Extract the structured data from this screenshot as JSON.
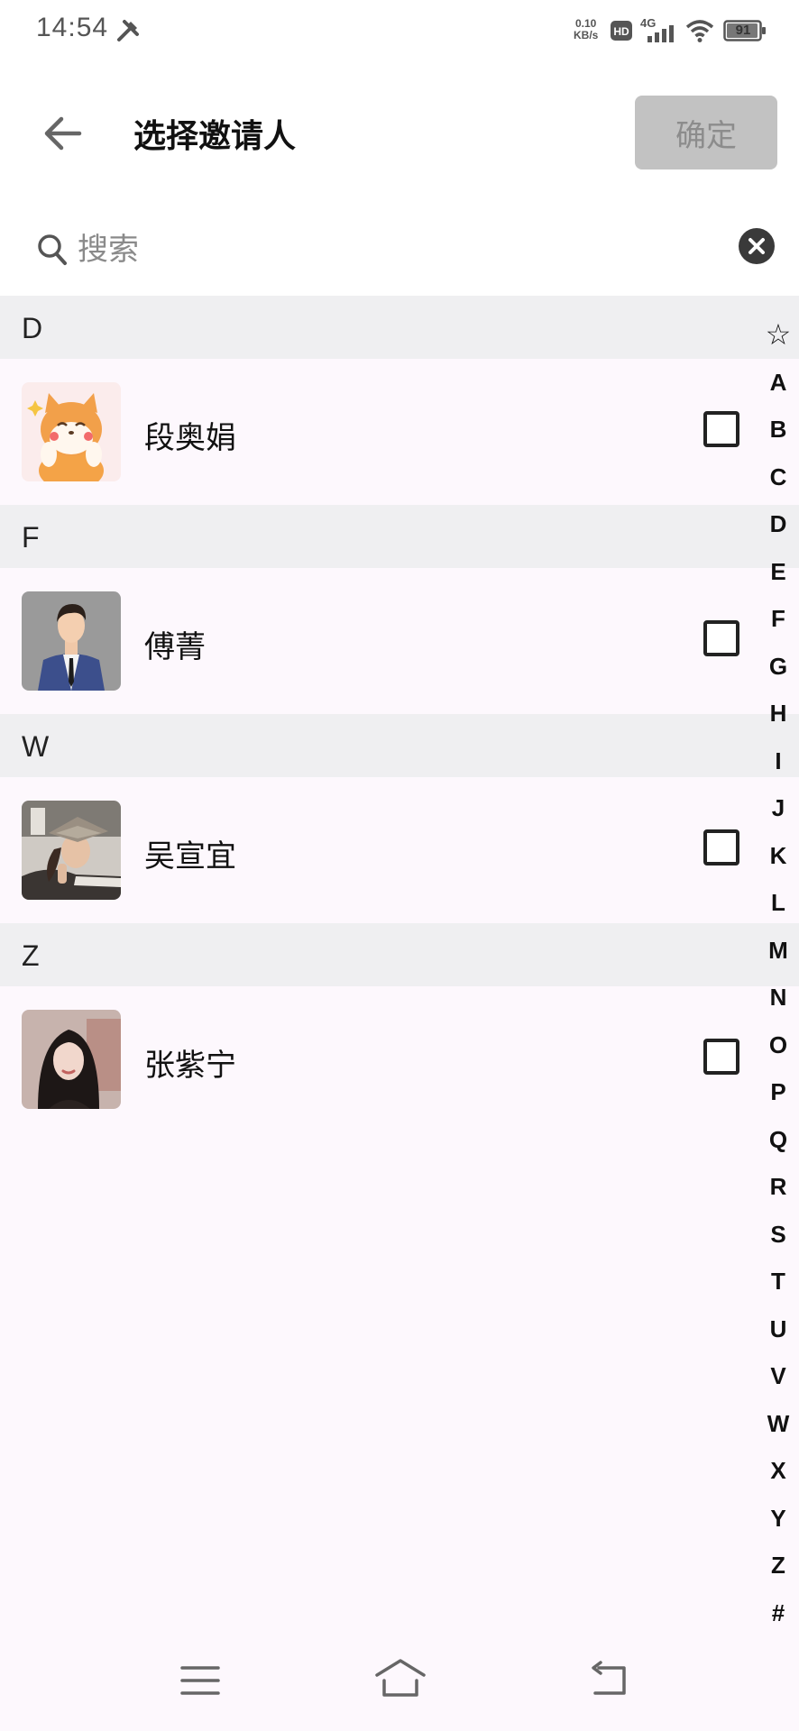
{
  "status_bar": {
    "time": "14:54",
    "net_speed_value": "0.10",
    "net_speed_unit": "KB/s",
    "network": "4G",
    "battery": "91",
    "icons": [
      "tools-icon",
      "hd-icon",
      "signal-icon",
      "wifi-icon",
      "battery-icon"
    ]
  },
  "header": {
    "title": "选择邀请人",
    "confirm_label": "确定",
    "back_icon": "arrow-left-icon"
  },
  "search": {
    "placeholder": "搜索",
    "value": ""
  },
  "sections": [
    {
      "letter": "D",
      "contacts": [
        {
          "name": "段奥娟",
          "avatar": "shiba-dog-avatar",
          "checked": false
        }
      ]
    },
    {
      "letter": "F",
      "contacts": [
        {
          "name": "傅菁",
          "avatar": "man-in-suit-avatar",
          "checked": false
        }
      ]
    },
    {
      "letter": "W",
      "contacts": [
        {
          "name": "吴宣宜",
          "avatar": "woman-with-hat-avatar",
          "checked": false
        }
      ]
    },
    {
      "letter": "Z",
      "contacts": [
        {
          "name": "张紫宁",
          "avatar": "woman-portrait-avatar",
          "checked": false
        }
      ]
    }
  ],
  "index_bar": [
    "☆",
    "A",
    "B",
    "C",
    "D",
    "E",
    "F",
    "G",
    "H",
    "I",
    "J",
    "K",
    "L",
    "M",
    "N",
    "O",
    "P",
    "Q",
    "R",
    "S",
    "T",
    "U",
    "V",
    "W",
    "X",
    "Y",
    "Z",
    "#"
  ],
  "nav_bar": {
    "icons": [
      "menu-icon",
      "home-icon",
      "back-icon"
    ]
  },
  "colors": {
    "background": "#fdf8fd",
    "section_header": "#efeff1",
    "confirm_button": "#c2c2c2",
    "confirm_text": "#8c8c8c"
  }
}
